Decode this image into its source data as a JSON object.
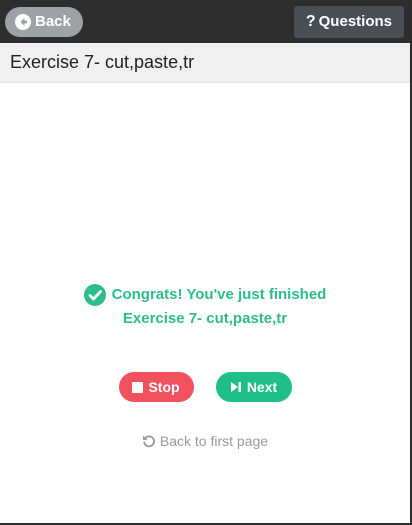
{
  "header": {
    "back_label": "Back",
    "back_icon": "arrow-left-circle-icon",
    "questions_label": "Questions",
    "questions_icon": "question-mark-icon",
    "questions_glyph": "?"
  },
  "title_bar": {
    "title": "Exercise 7- cut,paste,tr"
  },
  "completion": {
    "icon": "check-circle-icon",
    "line1": "Congrats! You've just finished",
    "line2": "Exercise 7- cut,paste,tr",
    "color": "#2ebd8a"
  },
  "actions": {
    "stop_label": "Stop",
    "stop_icon": "stop-square-icon",
    "stop_color": "#f2525e",
    "next_label": "Next",
    "next_icon": "step-forward-icon",
    "next_color": "#1fbf8a"
  },
  "footer": {
    "back_first_label": "Back to first page",
    "back_first_icon": "undo-arrow-icon"
  }
}
